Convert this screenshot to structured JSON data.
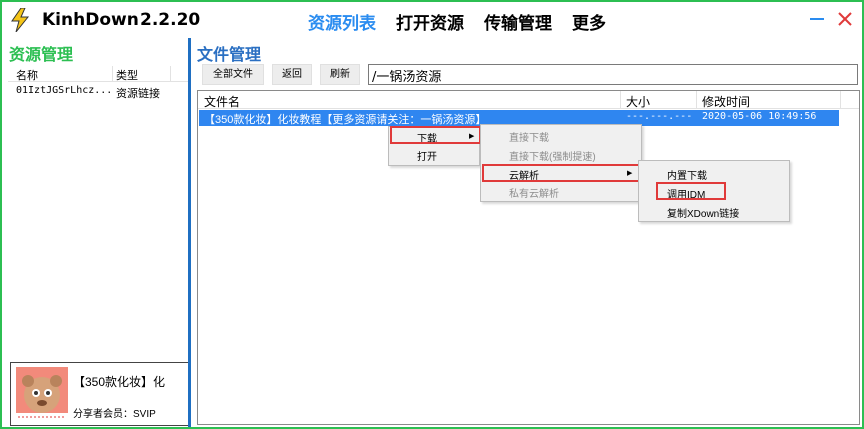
{
  "app": {
    "name": "KinhDown",
    "version": "2.2.20"
  },
  "topnav": {
    "items": [
      "资源列表",
      "打开资源",
      "传输管理",
      "更多"
    ],
    "active": "资源列表"
  },
  "colors": {
    "green": "#2cbf52",
    "blue_accent": "#2a8cf0",
    "selection": "#2f86f0",
    "highlight_red": "#e03a3a"
  },
  "left": {
    "title": "资源管理",
    "columns": [
      "名称",
      "类型"
    ],
    "rows": [
      {
        "name": "01IztJGSrLhcz...",
        "type": "资源链接"
      }
    ],
    "card": {
      "title": "【350款化妆】化",
      "subtitle": "分享者会员：SVIP"
    }
  },
  "right": {
    "title": "文件管理",
    "buttons": {
      "all_files": "全部文件",
      "back": "返回",
      "refresh": "刷新"
    },
    "path": "/一锅汤资源",
    "columns": [
      "文件名",
      "大小",
      "修改时间"
    ],
    "rows": [
      {
        "name": "【350款化妆】化妆教程【更多资源请关注：一锅汤资源】",
        "size": "---.---.---",
        "mtime": "2020-05-06 10:49:56"
      }
    ]
  },
  "context_menu": {
    "main": [
      "下载",
      "打开"
    ],
    "download_sub": [
      "直接下载",
      "直接下载(强制提速)",
      "云解析",
      "私有云解析"
    ],
    "cloud_sub": [
      "内置下载",
      "调用IDM",
      "复制XDown链接"
    ]
  }
}
